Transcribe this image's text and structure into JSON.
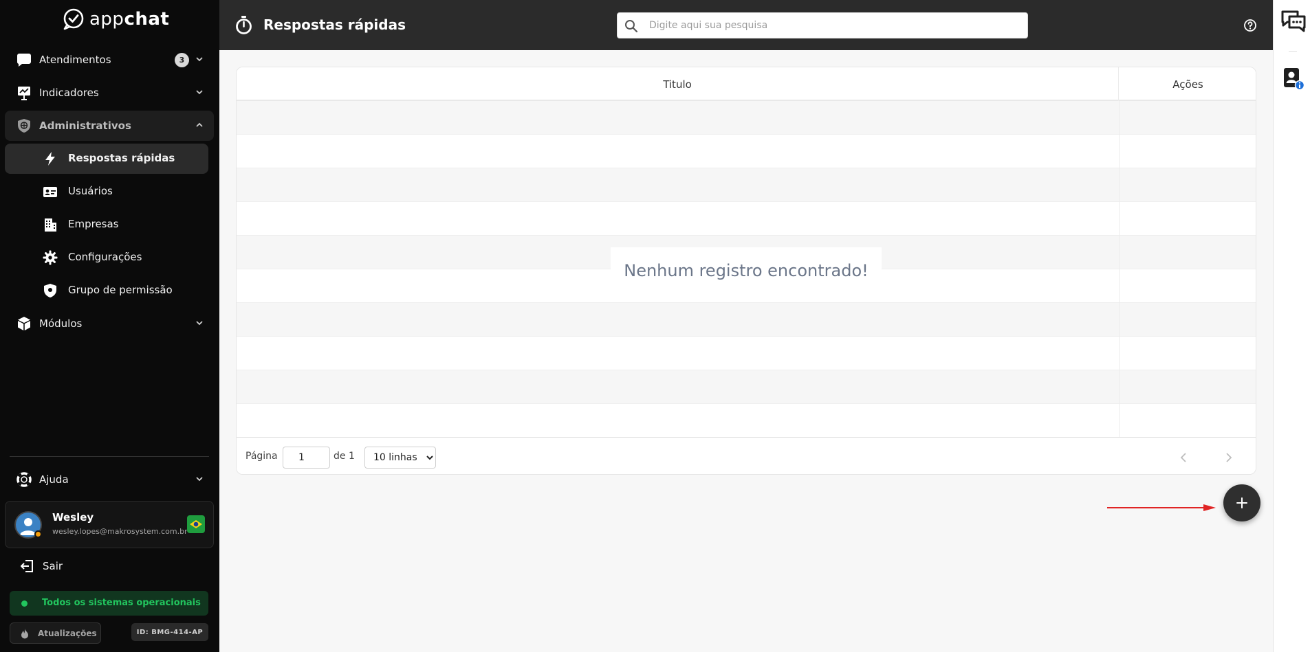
{
  "app": {
    "logo_plain": "app",
    "logo_bold": "chat"
  },
  "sidebar": {
    "items": [
      {
        "label": "Atendimentos",
        "badge": "3"
      },
      {
        "label": "Indicadores"
      },
      {
        "label": "Administrativos"
      },
      {
        "label": "Módulos"
      }
    ],
    "sub_items": [
      {
        "label": "Respostas rápidas"
      },
      {
        "label": "Usuários"
      },
      {
        "label": "Empresas"
      },
      {
        "label": "Configurações"
      },
      {
        "label": "Grupo de permissão"
      }
    ],
    "help_label": "Ajuda",
    "logout_label": "Sair"
  },
  "user": {
    "name": "Wesley",
    "email": "wesley.lopes@makrosystem.com.br"
  },
  "status": {
    "text": "Todos os sistemas operacionais",
    "color": "#22c55e"
  },
  "footer": {
    "updates_label": "Atualizações",
    "system_id": "ID: BMG-414-AP"
  },
  "header": {
    "title": "Respostas rápidas",
    "search_placeholder": "Digite aqui sua pesquisa"
  },
  "table": {
    "columns": [
      "Titulo",
      "Ações"
    ],
    "empty_message": "Nenhum registro encontrado!",
    "pagination": {
      "page_label": "Página",
      "page_value": "1",
      "of_label": "de 1",
      "rows_option": "10 linhas"
    }
  },
  "colors": {
    "sidebar_bg": "#0b0b0b",
    "topbar_bg": "#2b2b2b",
    "fab_bg": "#2f2f2f",
    "arrow": "#e02424",
    "info_blue": "#1d6fd8"
  }
}
